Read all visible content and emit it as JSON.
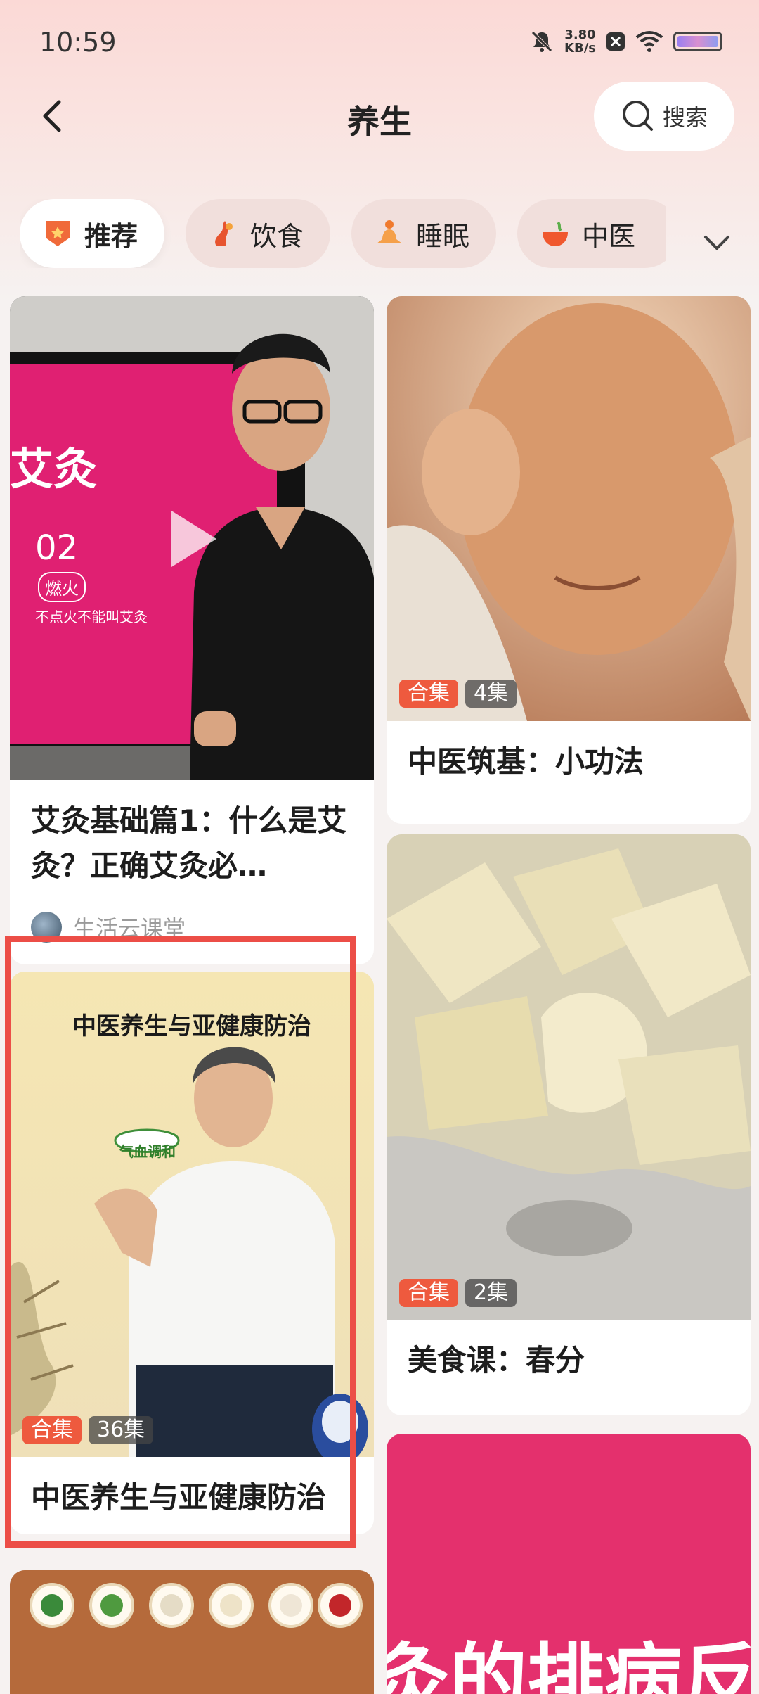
{
  "status_bar": {
    "time": "10:59",
    "speed_value": "3.80",
    "speed_unit": "KB/s"
  },
  "header": {
    "title": "养生",
    "search_label": "搜索"
  },
  "tabs": [
    {
      "label": "推荐",
      "icon": "recommend-badge-icon",
      "active": true
    },
    {
      "label": "饮食",
      "icon": "diet-icon",
      "active": false
    },
    {
      "label": "睡眠",
      "icon": "sleep-meditation-icon",
      "active": false
    },
    {
      "label": "中医",
      "icon": "tcm-bowl-icon",
      "active": false
    }
  ],
  "cards": {
    "moxibustion": {
      "title": "艾灸基础篇1：什么是艾灸？正确艾灸必…",
      "author": "生活云课堂",
      "thumb_text_main": "艾灸",
      "thumb_num": "02",
      "thumb_tag": "燃火",
      "thumb_sub": "不点火不能叫艾灸"
    },
    "tcm_basics": {
      "title": "中医筑基：小功法",
      "badge_collection": "合集",
      "badge_count": "4集"
    },
    "tcm_health": {
      "title": "中医养生与亚健康防治",
      "poster_title": "中医养生与亚健康防治",
      "poster_bubble": "气血调和",
      "badge_collection": "合集",
      "badge_count": "36集"
    },
    "food_course": {
      "title": "美食课：春分",
      "badge_collection": "合集",
      "badge_count": "2集"
    },
    "disease_reaction": {
      "thumb_text": "灸的排病反"
    }
  },
  "colors": {
    "accent_red": "#ee5a3e",
    "highlight_border": "#ec4e47",
    "page_bg": "#f6f2f1"
  }
}
